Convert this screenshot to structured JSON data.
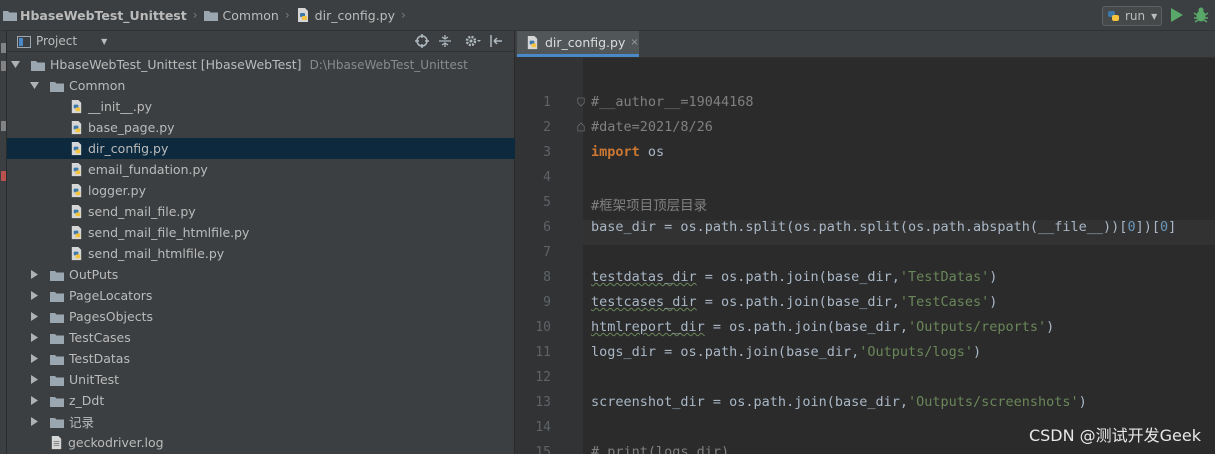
{
  "breadcrumb": {
    "project": "HbaseWebTest_Unittest",
    "folder": "Common",
    "file": "dir_config.py"
  },
  "run_config": {
    "label": "run"
  },
  "project_panel": {
    "title": "Project",
    "root": {
      "label": "HbaseWebTest_Unittest [HbaseWebTest]",
      "path": "D:\\HbaseWebTest_Unittest"
    },
    "rows": [
      {
        "label": "Common",
        "kind": "folder",
        "expanded": true,
        "depth": 1
      },
      {
        "label": "__init__.py",
        "kind": "py",
        "depth": 2
      },
      {
        "label": "base_page.py",
        "kind": "py",
        "depth": 2
      },
      {
        "label": "dir_config.py",
        "kind": "py",
        "depth": 2,
        "selected": true
      },
      {
        "label": "email_fundation.py",
        "kind": "py",
        "depth": 2
      },
      {
        "label": "logger.py",
        "kind": "py",
        "depth": 2
      },
      {
        "label": "send_mail_file.py",
        "kind": "py",
        "depth": 2
      },
      {
        "label": "send_mail_file_htmlfile.py",
        "kind": "py",
        "depth": 2
      },
      {
        "label": "send_mail_htmlfile.py",
        "kind": "py",
        "depth": 2
      },
      {
        "label": "OutPuts",
        "kind": "folder",
        "expanded": false,
        "depth": 1
      },
      {
        "label": "PageLocators",
        "kind": "folder",
        "expanded": false,
        "depth": 1
      },
      {
        "label": "PagesObjects",
        "kind": "folder",
        "expanded": false,
        "depth": 1
      },
      {
        "label": "TestCases",
        "kind": "folder",
        "expanded": false,
        "depth": 1
      },
      {
        "label": "TestDatas",
        "kind": "folder",
        "expanded": false,
        "depth": 1
      },
      {
        "label": "UnitTest",
        "kind": "folder",
        "expanded": false,
        "depth": 1
      },
      {
        "label": "z_Ddt",
        "kind": "folder",
        "expanded": false,
        "depth": 1
      },
      {
        "label": "记录",
        "kind": "folder",
        "expanded": false,
        "depth": 1
      },
      {
        "label": "geckodriver.log",
        "kind": "file",
        "depth": 1
      }
    ]
  },
  "editor": {
    "tab": {
      "label": "dir_config.py",
      "close": "×"
    },
    "lines": [
      {
        "n": "1",
        "parts": [
          {
            "t": "#__author__=19044168",
            "c": "cmt"
          }
        ]
      },
      {
        "n": "2",
        "parts": [
          {
            "t": "#date=2021/8/26",
            "c": "cmt"
          }
        ]
      },
      {
        "n": "3",
        "parts": [
          {
            "t": "import",
            "c": "kw"
          },
          {
            "t": " os",
            "c": ""
          }
        ]
      },
      {
        "n": "4",
        "parts": []
      },
      {
        "n": "5",
        "parts": [
          {
            "t": "#框架项目顶层目录",
            "c": "cmt"
          }
        ]
      },
      {
        "n": "6",
        "parts": [
          {
            "t": "base_dir = os.path.split(os.path.split(os.path.abspath(__file__))[",
            "c": ""
          },
          {
            "t": "0",
            "c": "num"
          },
          {
            "t": "])[",
            "c": ""
          },
          {
            "t": "0",
            "c": "num"
          },
          {
            "t": "]",
            "c": ""
          }
        ]
      },
      {
        "n": "7",
        "parts": []
      },
      {
        "n": "8",
        "parts": [
          {
            "t": "testdatas_dir",
            "c": "under"
          },
          {
            "t": " = os.path.join(base_dir,",
            "c": ""
          },
          {
            "t": "'TestDatas'",
            "c": "str"
          },
          {
            "t": ")",
            "c": ""
          }
        ]
      },
      {
        "n": "9",
        "parts": [
          {
            "t": "testcases_dir",
            "c": "under"
          },
          {
            "t": " = os.path.join(base_dir,",
            "c": ""
          },
          {
            "t": "'TestCases'",
            "c": "str"
          },
          {
            "t": ")",
            "c": ""
          }
        ]
      },
      {
        "n": "10",
        "parts": [
          {
            "t": "htmlreport_dir",
            "c": "under"
          },
          {
            "t": " = os.path.join(base_dir,",
            "c": ""
          },
          {
            "t": "'Outputs/reports'",
            "c": "str"
          },
          {
            "t": ")",
            "c": ""
          }
        ]
      },
      {
        "n": "11",
        "parts": [
          {
            "t": "logs_dir = os.path.join(base_dir,",
            "c": ""
          },
          {
            "t": "'Outputs/logs'",
            "c": "str"
          },
          {
            "t": ")",
            "c": ""
          }
        ]
      },
      {
        "n": "12",
        "parts": []
      },
      {
        "n": "13",
        "parts": [
          {
            "t": "screenshot_dir = os.path.join(base_dir,",
            "c": ""
          },
          {
            "t": "'Outputs/screenshots'",
            "c": "str"
          },
          {
            "t": ")",
            "c": ""
          }
        ]
      },
      {
        "n": "14",
        "parts": []
      },
      {
        "n": "15",
        "parts": [
          {
            "t": "# print(logs_dir)",
            "c": "cmt"
          }
        ]
      }
    ]
  },
  "watermark": "CSDN @测试开发Geek",
  "colors": {
    "panel_bg": "#3c3f41",
    "editor_bg": "#2b2b2b",
    "selection": "#0d293e",
    "keyword": "#cc7832",
    "string": "#6a8759",
    "comment": "#808080",
    "run_green": "#59a869"
  }
}
